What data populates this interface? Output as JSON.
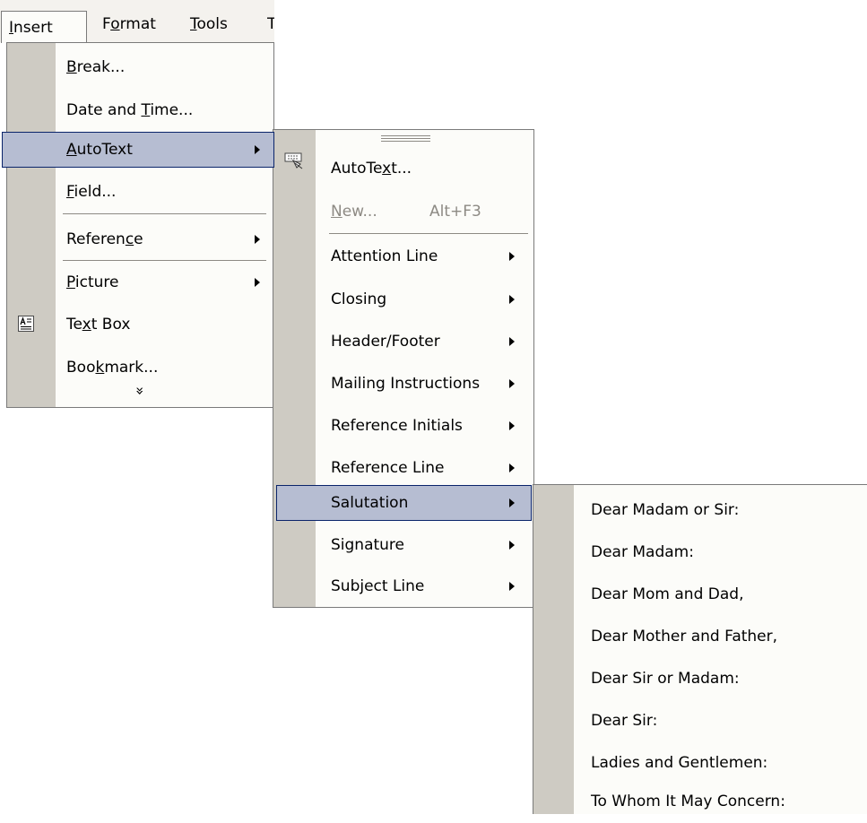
{
  "menubar": {
    "items": [
      {
        "label": "Insert",
        "mnemonic_index": 0
      },
      {
        "label": "Format",
        "mnemonic_index": 1
      },
      {
        "label": "Tools",
        "mnemonic_index": 0
      },
      {
        "label": "T"
      }
    ]
  },
  "insert_menu": {
    "items": [
      {
        "label": "Break...",
        "mnemonic_index": 0
      },
      {
        "label": "Date and Time...",
        "mnemonic_index": 9
      },
      {
        "label": "AutoText",
        "mnemonic_index": 0,
        "submenu": true,
        "highlighted": true
      },
      {
        "label": "Field...",
        "mnemonic_index": 0
      },
      {
        "label": "Reference",
        "mnemonic_index": 7,
        "submenu": true
      },
      {
        "label": "Picture",
        "mnemonic_index": 0,
        "submenu": true
      },
      {
        "label": "Text Box",
        "mnemonic_index": 2,
        "icon": "text-box-icon"
      },
      {
        "label": "Bookmark...",
        "mnemonic_index": 3
      }
    ],
    "expand_glyph": "»"
  },
  "autotext_menu": {
    "items": [
      {
        "label": "AutoText...",
        "mnemonic_index": 6,
        "icon": "keyboard-hand-icon"
      },
      {
        "label": "New...",
        "mnemonic_index": 0,
        "shortcut": "Alt+F3",
        "disabled": true
      },
      {
        "label": "Attention Line",
        "submenu": true
      },
      {
        "label": "Closing",
        "submenu": true
      },
      {
        "label": "Header/Footer",
        "submenu": true
      },
      {
        "label": "Mailing Instructions",
        "submenu": true
      },
      {
        "label": "Reference Initials",
        "submenu": true
      },
      {
        "label": "Reference Line",
        "submenu": true
      },
      {
        "label": "Salutation",
        "submenu": true,
        "highlighted": true
      },
      {
        "label": "Signature",
        "submenu": true
      },
      {
        "label": "Subject Line",
        "submenu": true
      }
    ]
  },
  "salutation_menu": {
    "items": [
      {
        "label": "Dear Madam or Sir:"
      },
      {
        "label": "Dear Madam:"
      },
      {
        "label": "Dear Mom and Dad,"
      },
      {
        "label": "Dear Mother and Father,"
      },
      {
        "label": "Dear Sir or Madam:"
      },
      {
        "label": "Dear Sir:"
      },
      {
        "label": "Ladies and Gentlemen:"
      },
      {
        "label": "To Whom It May Concern:"
      }
    ]
  },
  "colors": {
    "highlight": "#b6bdd2",
    "highlight_border": "#0a246a",
    "gutter": "#cecbc3",
    "menu_bg": "#fcfcf9"
  }
}
